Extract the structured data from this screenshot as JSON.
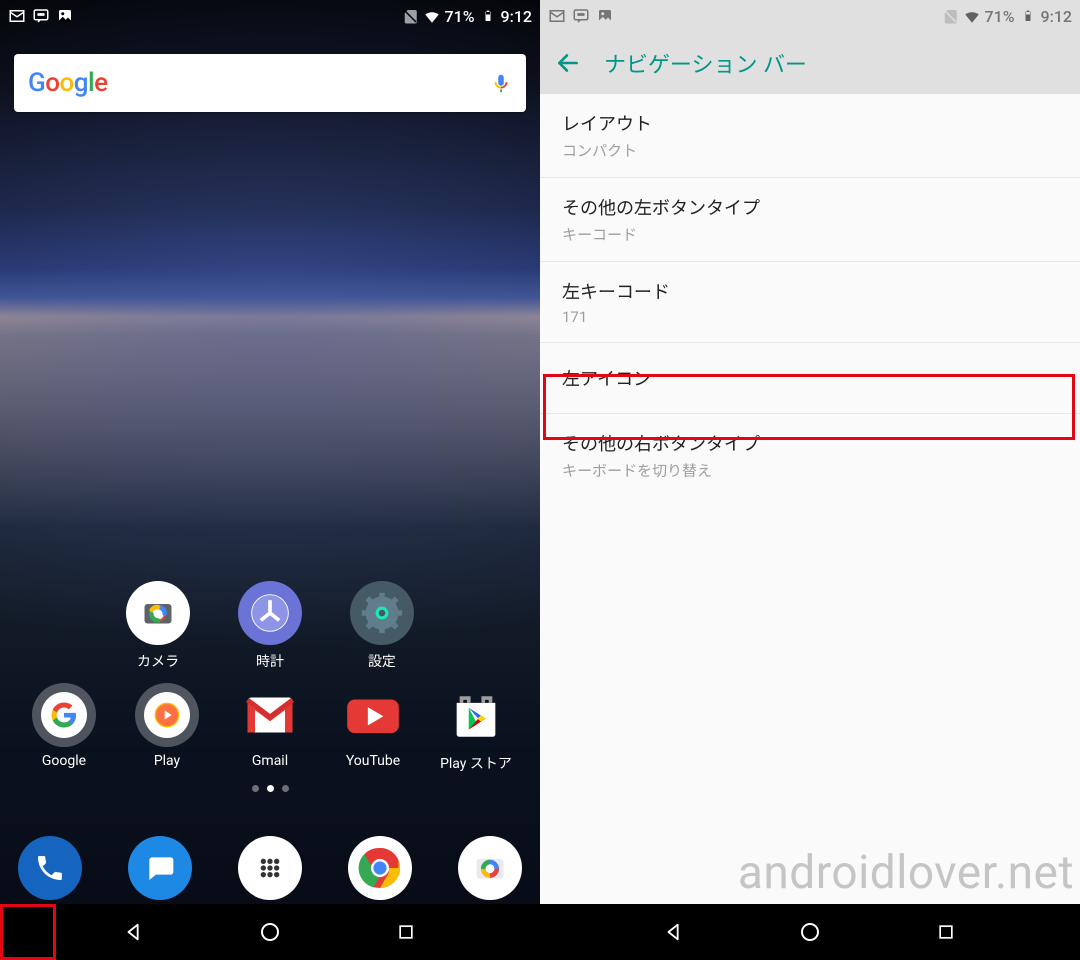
{
  "status": {
    "battery_pct": "71%",
    "time": "9:12"
  },
  "home": {
    "search_brand": "Google",
    "row1": [
      {
        "label": "カメラ"
      },
      {
        "label": "時計"
      },
      {
        "label": "設定"
      }
    ],
    "row2": [
      {
        "label": "Google"
      },
      {
        "label": "Play"
      },
      {
        "label": "Gmail"
      },
      {
        "label": "YouTube"
      },
      {
        "label": "Play ストア"
      }
    ]
  },
  "settings": {
    "title": "ナビゲーション バー",
    "items": [
      {
        "title": "レイアウト",
        "sub": "コンパクト"
      },
      {
        "title": "その他の左ボタンタイプ",
        "sub": "キーコード"
      },
      {
        "title": "左キーコード",
        "sub": "171"
      },
      {
        "title": "左アイコン"
      },
      {
        "title": "その他の右ボタンタイプ",
        "sub": "キーボードを切り替え"
      }
    ]
  },
  "watermark": "androidlover.net"
}
